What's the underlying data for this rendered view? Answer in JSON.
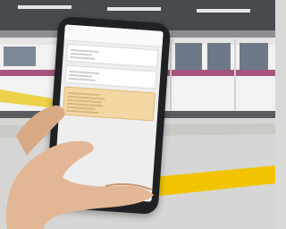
{
  "app": {
    "header_title": "",
    "back_icon": "chevron-left-icon"
  },
  "chat": {
    "messages": [
      {
        "text": "",
        "style": "plain"
      },
      {
        "text": "",
        "style": "plain"
      },
      {
        "text": "",
        "style": "highlight"
      }
    ]
  },
  "composer": {
    "placeholder": "",
    "send_label": ""
  },
  "colors": {
    "train_body": "#f2f2f2",
    "train_stripe": "#a5557f",
    "platform_line": "#f2c400",
    "highlight_bubble": "#f3d7a4",
    "send_button": "#e88a3a"
  }
}
